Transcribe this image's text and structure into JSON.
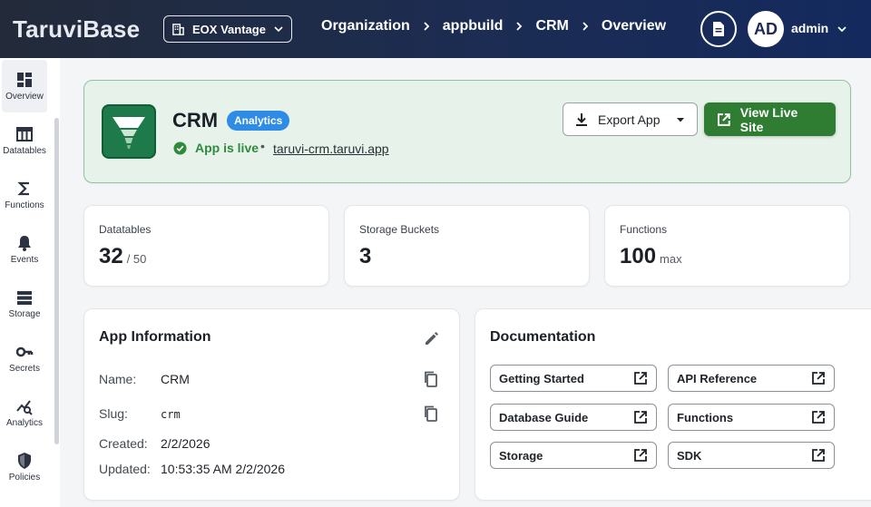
{
  "header": {
    "brand": "TaruviBase",
    "org": "EOX Vantage",
    "breadcrumbs": [
      "Organization",
      "appbuild",
      "CRM",
      "Overview"
    ],
    "avatar_initials": "AD",
    "user": "admin"
  },
  "sidebar": {
    "items": [
      {
        "label": "Overview",
        "icon": "grid-icon"
      },
      {
        "label": "Datatables",
        "icon": "table-icon"
      },
      {
        "label": "Functions",
        "icon": "sigma-icon"
      },
      {
        "label": "Events",
        "icon": "bell-icon"
      },
      {
        "label": "Storage",
        "icon": "storage-icon"
      },
      {
        "label": "Secrets",
        "icon": "key-icon"
      },
      {
        "label": "Analytics",
        "icon": "analytics-icon"
      },
      {
        "label": "Policies",
        "icon": "shield-icon"
      }
    ]
  },
  "app": {
    "name": "CRM",
    "badge": "Analytics",
    "status": "App is live",
    "separator": "•",
    "url": "taruvi-crm.taruvi.app",
    "export_label": "Export App",
    "live_label": "View Live Site"
  },
  "stats": [
    {
      "label": "Datatables",
      "value": "32",
      "sub": "/ 50"
    },
    {
      "label": "Storage Buckets",
      "value": "3",
      "sub": ""
    },
    {
      "label": "Functions",
      "value": "100",
      "sub": "max"
    }
  ],
  "info": {
    "title": "App Information",
    "rows": [
      {
        "label": "Name:",
        "value": "CRM"
      },
      {
        "label": "Slug:",
        "value": "crm"
      },
      {
        "label": "Created:",
        "value": "2/2/2026"
      },
      {
        "label": "Updated:",
        "value": "10:53:35 AM 2/2/2026"
      }
    ]
  },
  "docs": {
    "title": "Documentation",
    "links": [
      "Getting Started",
      "API Reference",
      "Database Guide",
      "Functions",
      "Storage",
      "SDK"
    ]
  },
  "colors": {
    "live_green": "#2e7d32",
    "badge_blue": "#2e8be6",
    "hero_bg": "#e7f2ea"
  }
}
